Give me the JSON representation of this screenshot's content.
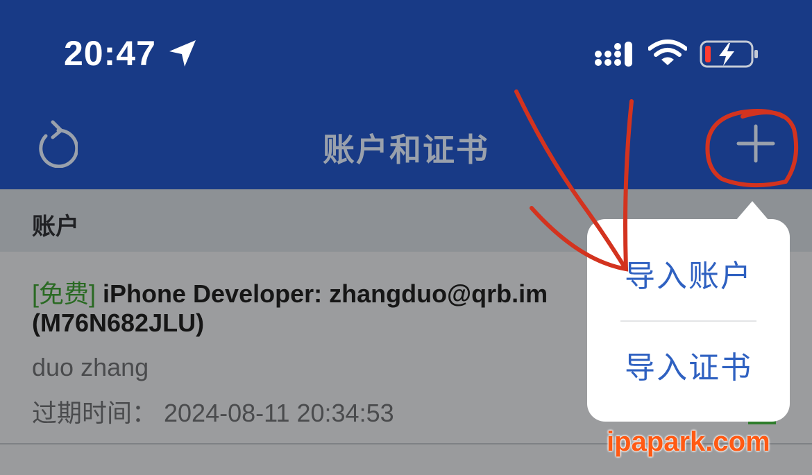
{
  "status_bar": {
    "time": "20:47",
    "icons": [
      "location-arrow-icon",
      "cellular-signal-icon",
      "wifi-icon",
      "battery-charging-icon"
    ]
  },
  "nav": {
    "title": "账户和证书",
    "left_icon": "refresh-icon",
    "right_icon": "plus-icon"
  },
  "section": {
    "title": "账户"
  },
  "account": {
    "tag": "[免费]",
    "title": " iPhone Developer: zhangduo@qrb.im",
    "id": "(M76N682JLU)",
    "name": "duo zhang",
    "expiry": "过期时间： 2024-08-11 20:34:53"
  },
  "popover_menu": {
    "items": [
      {
        "label": "导入账户"
      },
      {
        "label": "导入证书"
      }
    ]
  },
  "watermark": "ipapark.com",
  "colors": {
    "nav_bg": "#183a86",
    "menu_text": "#2f61c1",
    "annotation_red": "#d3331f",
    "watermark": "#ff5a14",
    "free_tag": "#2a6a23"
  }
}
